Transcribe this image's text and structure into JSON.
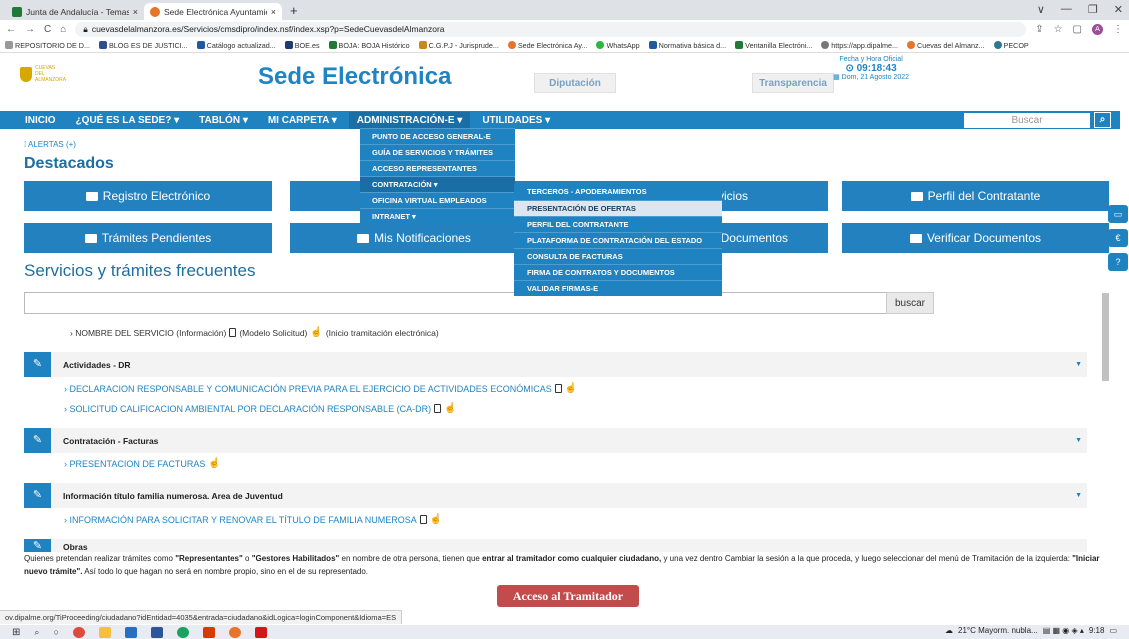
{
  "browser": {
    "tabs": [
      {
        "title": "Junta de Andalucía - Temas: Deta",
        "close": "×",
        "color": "#1e7a34"
      },
      {
        "title": "Sede Electrónica Ayuntamiento d",
        "close": "×",
        "color": "#e8732a"
      }
    ],
    "new_tab": "+",
    "window_controls": [
      "∨",
      "—",
      "❐",
      "✕"
    ],
    "url": "cuevasdelalmanzora.es/Servicios/cmsdipro/index.nsf/index.xsp?p=SedeCuevasdelAlmanzora",
    "avatar": "A",
    "bookmarks": [
      "REPOSITORIO DE D...",
      "BLOG ES DE JUSTICI...",
      "Catálogo actualizad...",
      "BOE.es",
      "BOJA: BOJA Histórico",
      "C.G.P.J - Jurisprude...",
      "Sede Electrónica Ay...",
      "WhatsApp",
      "Normativa básica d...",
      "Ventanilla Electróni...",
      "https://app.dipalme...",
      "Cuevas del Almanz...",
      "PECOP"
    ]
  },
  "header": {
    "logo_text": "CUEVAS DEL ALMANZORA",
    "title": "Sede Electrónica",
    "diputacion": "Diputación",
    "transparencia": "Transparencia",
    "clock_label": "Fecha y Hora Oficial",
    "clock_time": "09:18:43",
    "clock_date": "Dom, 21 Agosto 2022"
  },
  "nav": {
    "items": [
      "INICIO",
      "¿QUÉ ES LA SEDE? ▾",
      "TABLÓN ▾",
      "MI CARPETA ▾",
      "ADMINISTRACIÓN-E ▾",
      "UTILIDADES ▾"
    ],
    "search_placeholder": "Buscar",
    "search_icon": "search-icon"
  },
  "dropdown": {
    "items": [
      "PUNTO DE ACCESO GENERAL-E",
      "GUÍA DE SERVICIOS Y TRÁMITES",
      "ACCESO REPRESENTANTES",
      "CONTRATACIÓN ▾",
      "OFICINA VIRTUAL EMPLEADOS",
      "INTRANET ▾"
    ]
  },
  "submenu": {
    "items": [
      "TERCEROS - APODERAMIENTOS",
      "PRESENTACIÓN DE OFERTAS",
      "PERFIL DEL CONTRATANTE",
      "PLATAFORMA DE CONTRATACIÓN DEL ESTADO",
      "CONSULTA DE FACTURAS",
      "FIRMA DE CONTRATOS Y DOCUMENTOS",
      "VALIDAR FIRMAS-E"
    ]
  },
  "alerts": "ALERTAS (+)",
  "destacados": {
    "title": "Destacados",
    "buttons": [
      "Registro Electrónico",
      "rvicios",
      "Perfil del Contratante",
      "Trámites Pendientes",
      "Mis Notificaciones",
      "Documentos",
      "Verificar Documentos"
    ]
  },
  "services": {
    "title": "Servicios y trámites frecuentes",
    "search_button": "buscar",
    "legend_a": "› NOMBRE DEL SERVICIO (Información)",
    "legend_b": "(Modelo Solicitud)",
    "legend_c": "(Inicio tramitación electrónica)",
    "categories": [
      "Actividades - DR",
      "Contratación - Facturas",
      "Información título familia numerosa. Area de Juventud",
      "Obras"
    ],
    "links": [
      "› DECLARACION RESPONSABLE Y COMUNICACIÓN PREVIA PARA EL EJERCICIO DE ACTIVIDADES ECONÓMICAS",
      "› SOLICITUD CALIFICACION AMBIENTAL POR DECLARACIÓN RESPONSABLE (CA-DR)",
      "› PRESENTACION DE FACTURAS",
      "› INFORMACIÓN PARA SOLICITAR Y RENOVAR EL TÍTULO DE FAMILIA NUMEROSA"
    ]
  },
  "note": {
    "p1": "Quienes pretendan realizar trámites como ",
    "b1": "\"Representantes\"",
    "p2": " o ",
    "b2": "\"Gestores Habilitados\"",
    "p3": " en nombre de otra persona, tienen que ",
    "b3": "entrar al tramitador como cualquier ciudadano,",
    "p4": " y una vez dentro Cambiar la sesión a la que proceda, y luego seleccionar del menú de Tramitación de la izquierda: ",
    "b4": "\"Iniciar nuevo trámite\".",
    "p5": " Así todo lo que hagan no será en nombre propio, sino en el de su representado."
  },
  "acceso_button": "Acceso al Tramitador",
  "status_url": "ov.dipalme.org/TiProceeding/ciudadano?idEntidad=4035&entrada=ciudadano&idLogica=loginComponent&Idioma=ES",
  "taskbar": {
    "weather": "21°C Mayorm. nubla...",
    "time": "9:18"
  }
}
